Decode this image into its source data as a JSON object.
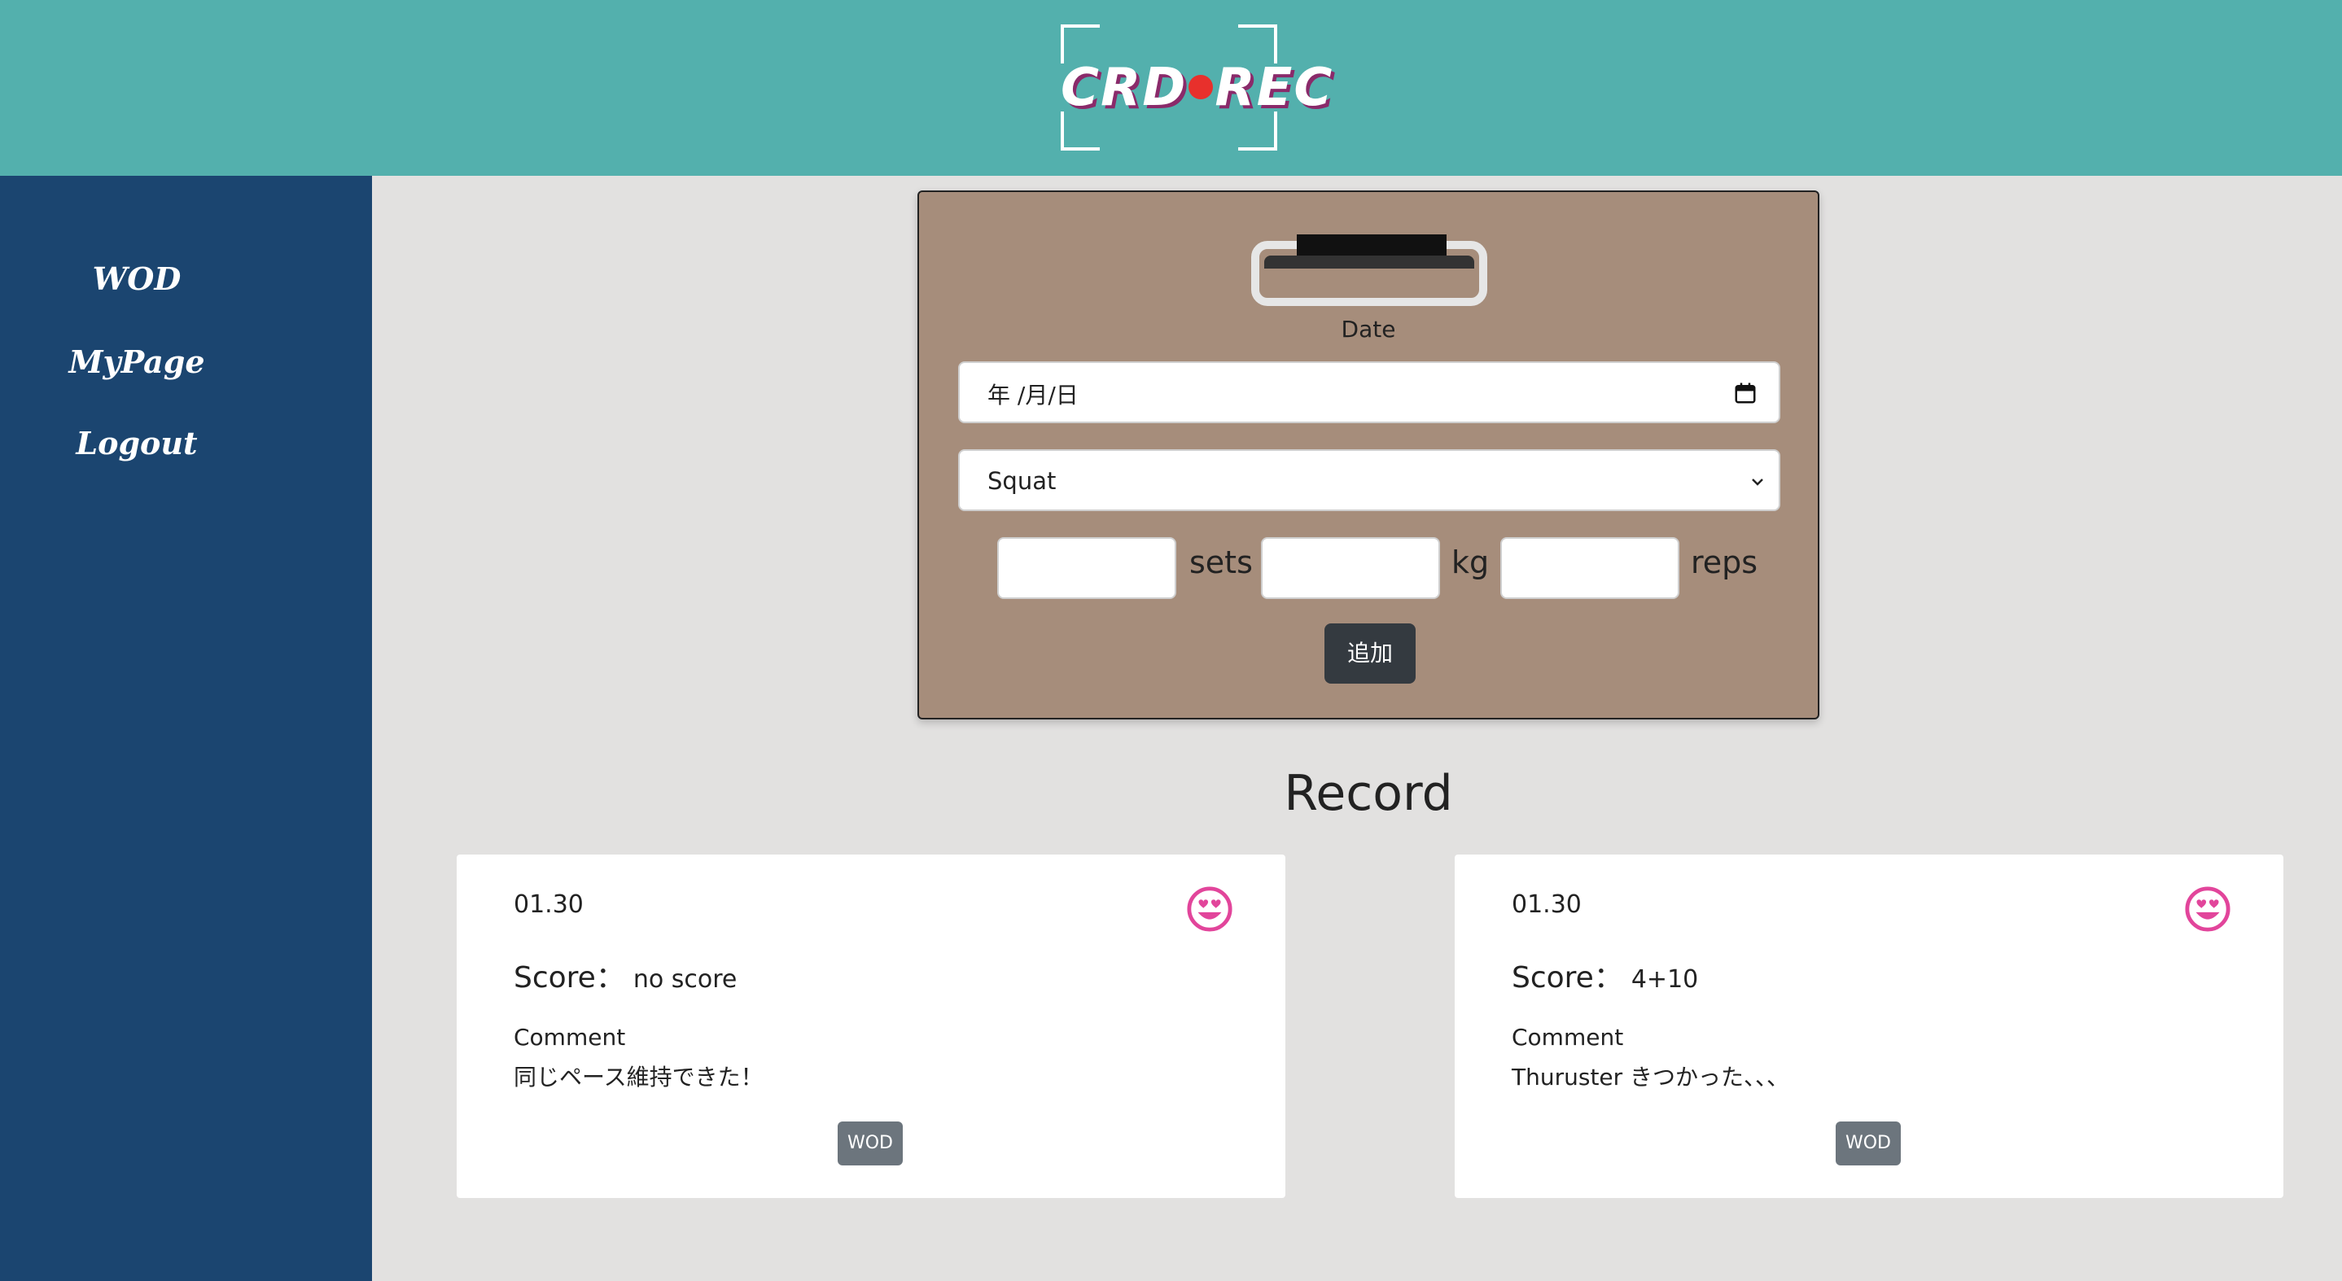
{
  "header": {
    "logo_text_left": "CRD",
    "logo_text_right": "REC",
    "logo_dot_color": "#e8302c",
    "bg_color": "#53b0ad"
  },
  "sidebar": {
    "bg_color": "#1b4570",
    "items": [
      {
        "label": "WOD"
      },
      {
        "label": "MyPage"
      },
      {
        "label": "Logout"
      }
    ]
  },
  "form": {
    "date_label": "Date",
    "date_value": "年 /月/日",
    "date_icon": "calendar-icon",
    "exercise_selected": "Squat",
    "sets_value": "",
    "sets_unit": "sets",
    "kg_value": "",
    "kg_unit": "kg",
    "reps_value": "",
    "reps_unit": "reps",
    "add_label": "追加",
    "card_color": "#a68d7b"
  },
  "record": {
    "title": "Record",
    "cards": [
      {
        "date": "01.30",
        "score_label": "Score：",
        "score": "no score",
        "comment_label": "Comment",
        "comment": "同じペース維持できた！",
        "badge": "WOD",
        "mood_icon": "smiling-face-heart-eyes-icon"
      },
      {
        "date": "01.30",
        "score_label": "Score：",
        "score": "4+10",
        "comment_label": "Comment",
        "comment": "Thuruster きつかった、、、",
        "badge": "WOD",
        "mood_icon": "smiling-face-heart-eyes-icon"
      }
    ],
    "emoji_color": "#e2459b"
  }
}
